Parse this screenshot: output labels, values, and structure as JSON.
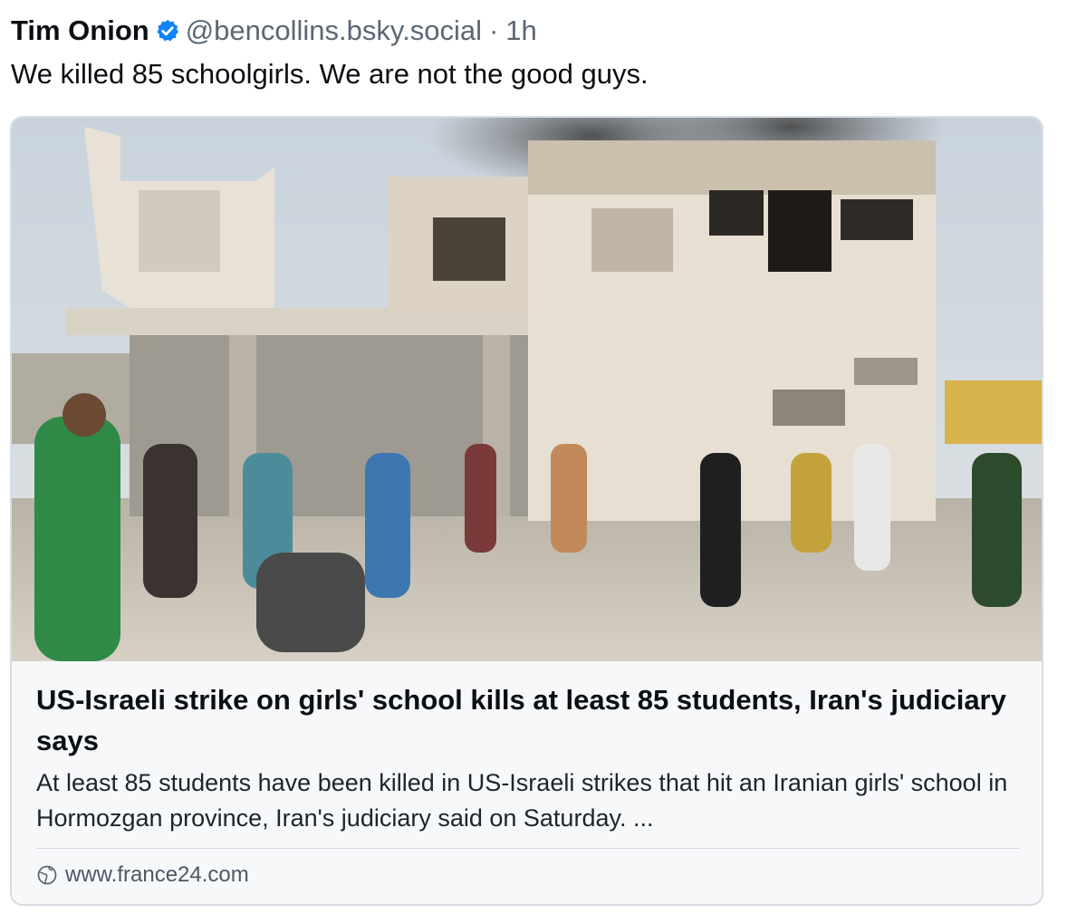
{
  "post": {
    "author_name": "Tim Onion",
    "handle": "@bencollins.bsky.social",
    "separator": "·",
    "time": "1h",
    "text": "We killed 85 schoolgirls. We are not the good guys.",
    "verified_icon": "verified-check-icon"
  },
  "link_card": {
    "image_description_icon": "news-photo",
    "title": "US-Israeli strike on girls' school kills at least 85 students, Iran's judiciary says",
    "description": "At least 85 students have been killed in US-Israeli strikes that hit an Iranian girls' school in Hormozgan province, Iran's judiciary said on Saturday. ...",
    "domain": "www.france24.com",
    "domain_icon": "globe-icon"
  },
  "colors": {
    "verified_blue": "#1083fe",
    "card_border": "#d8dde3",
    "muted_text": "#5b6773"
  }
}
